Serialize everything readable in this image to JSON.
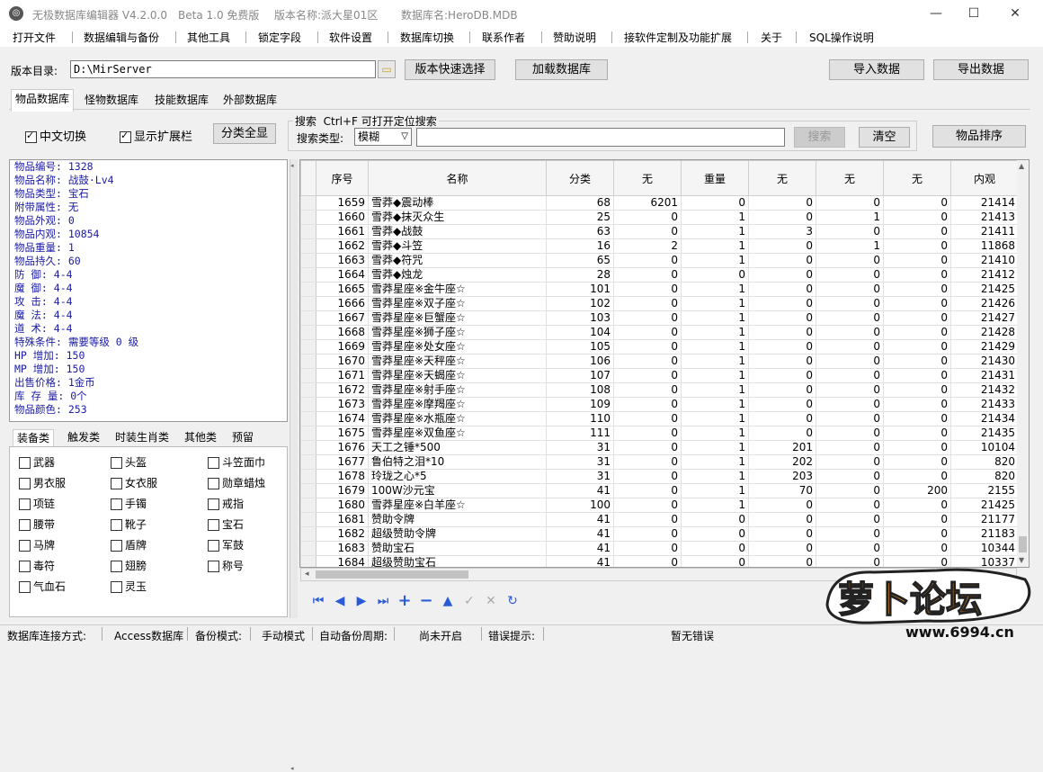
{
  "window": {
    "app_title": "无极数据库编辑器 V4.2.0.0",
    "edition": "Beta 1.0 免费版",
    "version_name": "版本名称:派大星01区",
    "db_name": "数据库名:HeroDB.MDB"
  },
  "menu": [
    "打开文件",
    "数据编辑与备份",
    "其他工具",
    "锁定字段",
    "软件设置",
    "数据库切换",
    "联系作者",
    "赞助说明",
    "接软件定制及功能扩展",
    "关于",
    "SQL操作说明"
  ],
  "toolbar": {
    "dir_label": "版本目录:",
    "dir_value": "D:\\MirServer",
    "quick_select": "版本快速选择",
    "load_db": "加载数据库",
    "import": "导入数据",
    "export": "导出数据"
  },
  "tabs": [
    "物品数据库",
    "怪物数据库",
    "技能数据库",
    "外部数据库"
  ],
  "options": {
    "chinese_switch": "中文切换",
    "show_extend": "显示扩展栏",
    "expand_all": "分类全显"
  },
  "search": {
    "group_title": "搜索  Ctrl+F 可打开定位搜索",
    "type_label": "搜索类型:",
    "type_value": "模糊",
    "query": "",
    "search_btn": "搜索",
    "clear_btn": "清空",
    "sort_btn": "物品排序"
  },
  "item_info": [
    "物品编号: 1328",
    "物品名称: 战鼓·Lv4",
    "物品类型: 宝石",
    "附带属性: 无",
    "物品外观: 0",
    "物品内观: 10854",
    "物品重量: 1",
    "物品持久: 60",
    "防    御: 4-4",
    "魔    御: 4-4",
    "攻    击: 4-4",
    "魔    法: 4-4",
    "道    术: 4-4",
    "特殊条件: 需要等级 0 级",
    "HP  增加: 150",
    "MP  增加: 150",
    "出售价格: 1金币",
    "库 存 量: 0个",
    "物品颜色: 253"
  ],
  "subtabs": [
    "装备类",
    "触发类",
    "时装生肖类",
    "其他类",
    "预留"
  ],
  "categories": [
    "武器",
    "头盔",
    "斗笠面巾",
    "男衣服",
    "女衣服",
    "勋章蜡烛",
    "项链",
    "手镯",
    "戒指",
    "腰带",
    "靴子",
    "宝石",
    "马牌",
    "盾牌",
    "军鼓",
    "毒符",
    "翅膀",
    "称号",
    "气血石",
    "灵玉"
  ],
  "grid": {
    "columns": [
      "序号",
      "名称",
      "分类",
      "无",
      "重量",
      "无",
      "无",
      "无",
      "内观"
    ],
    "rows": [
      [
        "1659",
        "雪莽◆震动棒",
        "68",
        "6201",
        "0",
        "0",
        "0",
        "0",
        "21414"
      ],
      [
        "1660",
        "雪莽◆抹灭众生",
        "25",
        "0",
        "1",
        "0",
        "1",
        "0",
        "21413"
      ],
      [
        "1661",
        "雪莽◆战鼓",
        "63",
        "0",
        "1",
        "3",
        "0",
        "0",
        "21411"
      ],
      [
        "1662",
        "雪莽◆斗笠",
        "16",
        "2",
        "1",
        "0",
        "1",
        "0",
        "11868"
      ],
      [
        "1663",
        "雪莽◆符咒",
        "65",
        "0",
        "1",
        "0",
        "0",
        "0",
        "21410"
      ],
      [
        "1664",
        "雪莽◆烛龙",
        "28",
        "0",
        "0",
        "0",
        "0",
        "0",
        "21412"
      ],
      [
        "1665",
        "雪莽星座※金牛座☆",
        "101",
        "0",
        "1",
        "0",
        "0",
        "0",
        "21425"
      ],
      [
        "1666",
        "雪莽星座※双子座☆",
        "102",
        "0",
        "1",
        "0",
        "0",
        "0",
        "21426"
      ],
      [
        "1667",
        "雪莽星座※巨蟹座☆",
        "103",
        "0",
        "1",
        "0",
        "0",
        "0",
        "21427"
      ],
      [
        "1668",
        "雪莽星座※狮子座☆",
        "104",
        "0",
        "1",
        "0",
        "0",
        "0",
        "21428"
      ],
      [
        "1669",
        "雪莽星座※处女座☆",
        "105",
        "0",
        "1",
        "0",
        "0",
        "0",
        "21429"
      ],
      [
        "1670",
        "雪莽星座※天秤座☆",
        "106",
        "0",
        "1",
        "0",
        "0",
        "0",
        "21430"
      ],
      [
        "1671",
        "雪莽星座※天蝎座☆",
        "107",
        "0",
        "1",
        "0",
        "0",
        "0",
        "21431"
      ],
      [
        "1672",
        "雪莽星座※射手座☆",
        "108",
        "0",
        "1",
        "0",
        "0",
        "0",
        "21432"
      ],
      [
        "1673",
        "雪莽星座※摩羯座☆",
        "109",
        "0",
        "1",
        "0",
        "0",
        "0",
        "21433"
      ],
      [
        "1674",
        "雪莽星座※水瓶座☆",
        "110",
        "0",
        "1",
        "0",
        "0",
        "0",
        "21434"
      ],
      [
        "1675",
        "雪莽星座※双鱼座☆",
        "111",
        "0",
        "1",
        "0",
        "0",
        "0",
        "21435"
      ],
      [
        "1676",
        "天工之锤*500",
        "31",
        "0",
        "1",
        "201",
        "0",
        "0",
        "10104"
      ],
      [
        "1677",
        "鲁伯特之泪*10",
        "31",
        "0",
        "1",
        "202",
        "0",
        "0",
        "820"
      ],
      [
        "1678",
        "玲珑之心*5",
        "31",
        "0",
        "1",
        "203",
        "0",
        "0",
        "820"
      ],
      [
        "1679",
        "100W沙元宝",
        "41",
        "0",
        "1",
        "70",
        "0",
        "200",
        "2155"
      ],
      [
        "1680",
        "雪莽星座※白羊座☆",
        "100",
        "0",
        "1",
        "0",
        "0",
        "0",
        "21425"
      ],
      [
        "1681",
        "赞助令牌",
        "41",
        "0",
        "0",
        "0",
        "0",
        "0",
        "21177"
      ],
      [
        "1682",
        "超级赞助令牌",
        "41",
        "0",
        "0",
        "0",
        "0",
        "0",
        "21183"
      ],
      [
        "1683",
        "赞助宝石",
        "41",
        "0",
        "0",
        "0",
        "0",
        "0",
        "10344"
      ],
      [
        "1684",
        "超级赞助宝石",
        "41",
        "0",
        "0",
        "0",
        "0",
        "0",
        "10337"
      ]
    ]
  },
  "status": {
    "conn_label": "数据库连接方式:",
    "conn_value": "Access数据库",
    "backup_label": "备份模式:",
    "backup_value": "手动模式",
    "auto_label": "自动备份周期:",
    "auto_value": "尚未开启",
    "err_label": "错误提示:",
    "err_value": "暂无错误"
  },
  "watermark": {
    "logo_text": "萝卜论坛",
    "site": "www.6994.cn"
  },
  "colors": {
    "info_text": "#1a1aa6",
    "nav_icon": "#2a5bd7",
    "logo_orange": "#f7941d"
  }
}
